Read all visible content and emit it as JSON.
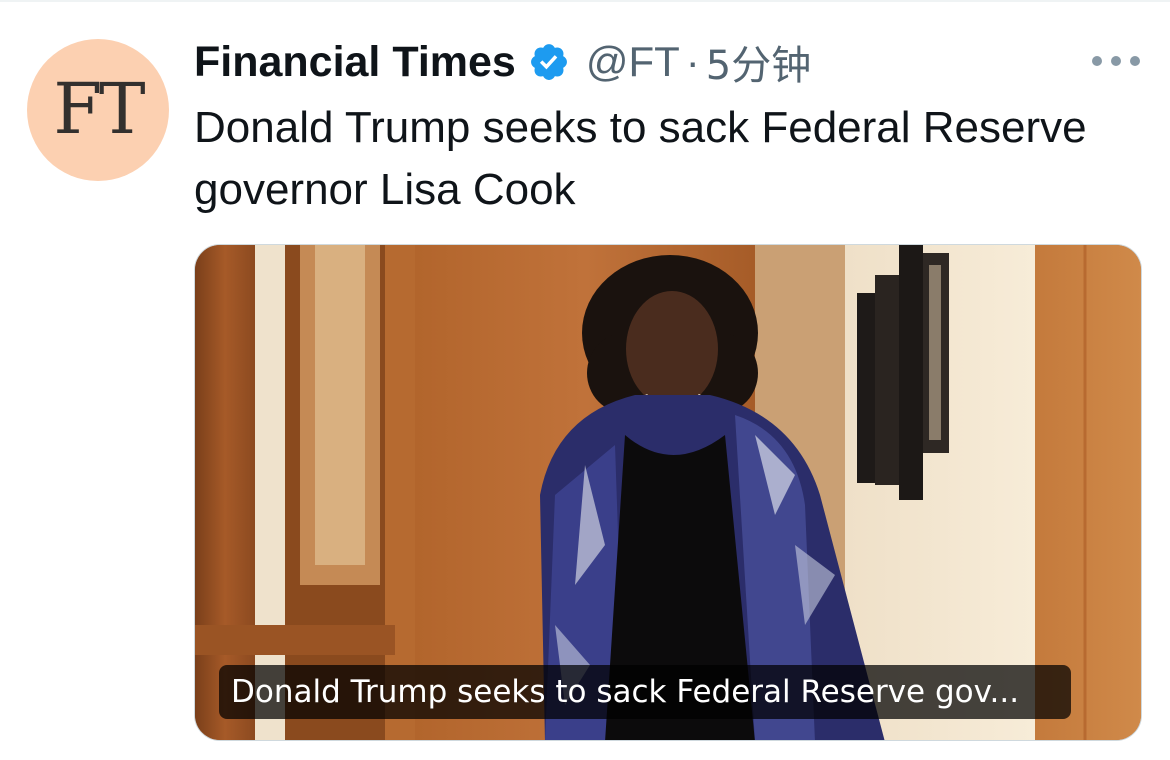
{
  "tweet": {
    "avatar_text": "FT",
    "display_name": "Financial Times",
    "handle": "@FT",
    "separator": "·",
    "time": "5分钟",
    "text": "Donald Trump seeks to sack Federal Reserve governor Lisa Cook",
    "card": {
      "caption": "Donald Trump seeks to sack Federal Reserve gov..."
    }
  },
  "icons": {
    "verified": "verified-badge-icon",
    "more": "more-options-icon"
  },
  "colors": {
    "avatar_bg": "#fcd0b1",
    "verified_blue": "#1d9bf0",
    "secondary_text": "#536471",
    "primary_text": "#0f1419"
  }
}
